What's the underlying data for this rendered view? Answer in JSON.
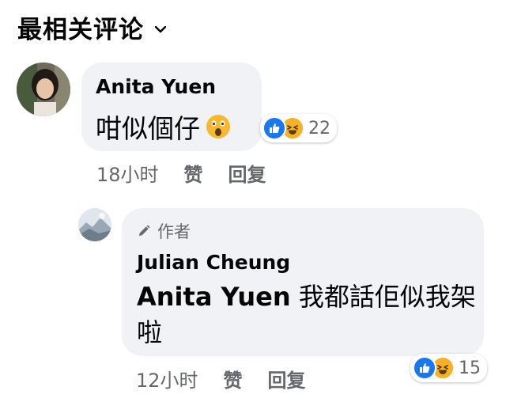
{
  "header": {
    "title": "最相关评论"
  },
  "comments": [
    {
      "author": "Anita Yuen",
      "text": "咁似個仔",
      "emoji": "astonished-face-emoji",
      "reactions": {
        "icons": [
          "like-icon",
          "haha-icon"
        ],
        "count": "22"
      },
      "time": "18小时",
      "like_label": "赞",
      "reply_label": "回复"
    }
  ],
  "reply": {
    "badge": "作者",
    "author": "Julian Cheung",
    "mention": "Anita Yuen",
    "text": " 我都話佢似我架啦",
    "reactions": {
      "icons": [
        "like-icon",
        "haha-icon"
      ],
      "count": "15"
    },
    "time": "12小时",
    "like_label": "赞",
    "reply_label": "回复"
  },
  "colors": {
    "bubble": "#f0f2f5",
    "meta": "#65676b",
    "like": "#1877f2",
    "haha": "#f7b125"
  }
}
